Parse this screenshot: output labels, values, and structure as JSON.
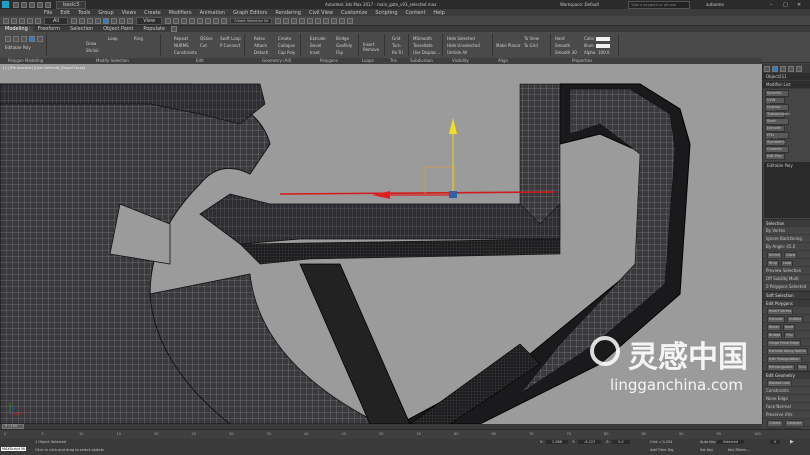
{
  "window": {
    "title": "Autodesk 3ds Max 2017 - main_gate_v03_selected.max",
    "workspace_label": "Workspace: Default",
    "search_placeholder": "Type a keyword or phrase",
    "user": "autoemo",
    "tab": "basic3"
  },
  "menu": [
    "File",
    "Edit",
    "Tools",
    "Group",
    "Views",
    "Create",
    "Modifiers",
    "Animation",
    "Graph Editors",
    "Rendering",
    "Civil View",
    "Customize",
    "Scripting",
    "Content",
    "Help"
  ],
  "toolbar": {
    "selection_filter": "All",
    "view_dropdown": "View",
    "create_selection_set": "Create Selection Se"
  },
  "ribbon": {
    "tabs": [
      "Modeling",
      "Freeform",
      "Selection",
      "Object Paint",
      "Populate"
    ],
    "active_tab": "Modeling",
    "polygon_label": "Editable Poly",
    "modify_mode": {
      "grow": "Grow",
      "shrink": "Shrink",
      "loop": "Loop",
      "ring": "Ring"
    },
    "edit": {
      "repeat": "Repeat",
      "quickslice": "QSlice",
      "swiftloop": "Swift Loop",
      "navigator": "NURMS",
      "cut": "Cut",
      "pconnect": "P Connect",
      "constraints": "Constraints"
    },
    "geometry": {
      "relax": "Relax",
      "attach": "Attach",
      "detach": "Detach",
      "create": "Create",
      "collapse": "Collapse",
      "cap_poly": "Cap Poly"
    },
    "polygons": {
      "extrude": "Extrude",
      "bevel": "Bevel",
      "inset": "Inset",
      "bridge": "Bridge",
      "geopoly": "GeoPoly",
      "flip": "Flip"
    },
    "loops": {
      "insert": "Insert",
      "remove": "Remove"
    },
    "tris": {
      "grid": "Grid",
      "turn": "Turn",
      "retri": "Re Tri"
    },
    "subdivision": {
      "msmooth": "MSmooth",
      "tessellate": "Tessellate",
      "use_displace": "Use Displac..."
    },
    "visibility": {
      "hide_selected": "Hide Selected",
      "hide_unselected": "Hide Unselected",
      "unhide_all": "Unhide All"
    },
    "align": {
      "make_planar": "Make Planar",
      "to_view": "To View",
      "to_grid": "To Grid"
    },
    "properties": {
      "hard": "Hard",
      "smooth": "Smooth",
      "smooth30": "Smooth 30",
      "color_label": "Color",
      "illum_label": "Illum",
      "alpha_label": "Alpha",
      "alpha_value": "100.0"
    }
  },
  "panels": {
    "polygon_modeling": "Polygon Modeling",
    "modify_selection": "Modify Selection",
    "edit": "Edit",
    "geometry_all": "Geometry (All)",
    "polygons": "Polygons",
    "loops": "Loops",
    "tris": "Tris",
    "subdivision": "Subdivision",
    "visibility": "Visibility",
    "align": "Align",
    "properties": "Properties"
  },
  "viewport": {
    "label": "[+] [Perspective] [User Defined] [Edged Faces]",
    "watermark_cn": "灵感中国",
    "watermark_url": "lingganchina.com",
    "axis_x": "x"
  },
  "command_panel": {
    "object_name": "Object211",
    "modifier_list": "Modifier List",
    "modifier_buttons": [
      "Spherify",
      "UVW Map",
      "Unwrap UVW",
      "Turbosmooth",
      "Shell",
      "Extrude",
      "FFD Modifier",
      "Symmetry",
      "Chamfer",
      "Edit Poly"
    ],
    "stack_item": "Editable Poly",
    "selection_header": "Selection",
    "by_vertex": "By Vertex",
    "ignore_backfacing": "Ignore Backfacing",
    "by_angle": "By Angle:",
    "by_angle_value": "45.0",
    "shrink": "Shrink",
    "grow": "Grow",
    "ring": "Ring",
    "loop": "Loop",
    "preview_selection": "Preview Selection",
    "off": "Off",
    "subobj": "SubObj",
    "multi": "Multi",
    "selected_count": "0 Polygons Selected",
    "soft_selection": "Soft Selection",
    "edit_polygons": "Edit Polygons",
    "insert_vertex": "Insert Vertex",
    "extrude": "Extrude",
    "outline": "Outline",
    "bevel": "Bevel",
    "inset": "Inset",
    "bridge": "Bridge",
    "flip": "Flip",
    "hinge_from_edge": "Hinge From Edge",
    "extrude_along_spline": "Extrude Along Spline",
    "edit_triangulation": "Edit Triangulation",
    "retriangulate": "Retriangulate",
    "turn": "Turn",
    "edit_geometry": "Edit Geometry",
    "repeat_last": "Repeat Last",
    "constraints": "Constraints",
    "none": "None",
    "edge": "Edge",
    "face": "Face",
    "normal": "Normal",
    "preserve_uvs": "Preserve UVs",
    "create": "Create",
    "collapse": "Collapse",
    "attach": "Attach",
    "detach": "Detach",
    "slice_plane": "Slice Plane",
    "split": "Split",
    "slice": "Slice",
    "reset_plane": "Reset Plane",
    "quickslice": "QuickSlice",
    "cut": "Cut",
    "msmooth": "MSmooth",
    "tessellate": "Tessellate"
  },
  "timeline": {
    "frame_display": "0 / 100",
    "ticks": [
      "0",
      "5",
      "10",
      "15",
      "20",
      "25",
      "30",
      "35",
      "40",
      "45",
      "50",
      "55",
      "60",
      "65",
      "70",
      "75",
      "80",
      "85",
      "90",
      "95",
      "100"
    ]
  },
  "status": {
    "maxscript": "MAXScript Mi",
    "selected": "1 Object Selected",
    "prompt": "Click or click-and-drag to select objects",
    "x_label": "X:",
    "x_value": "2.868",
    "y_label": "Y:",
    "y_value": "-6.227",
    "z_label": "Z:",
    "z_value": "0.0",
    "grid": "Grid = 0.254",
    "auto_key": "Auto Key",
    "set_key": "Set Key",
    "selected_dd": "Selected",
    "key_filters": "Key Filters...",
    "add_time_tag": "Add Time Tag",
    "frame": "0",
    "working_pivot": "Use Working Pivot"
  }
}
